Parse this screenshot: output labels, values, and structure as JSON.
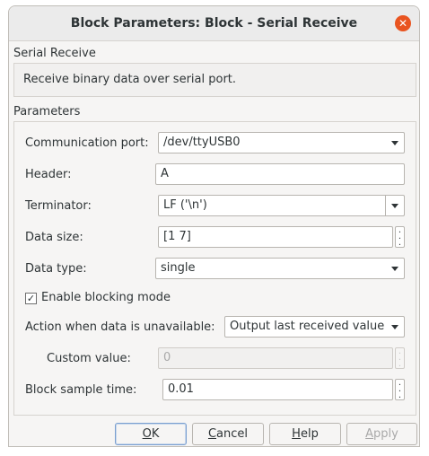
{
  "window": {
    "title": "Block Parameters: Block - Serial Receive",
    "close_glyph": "✕"
  },
  "block": {
    "name": "Serial Receive",
    "description": "Receive binary data over serial port."
  },
  "parameters": {
    "label": "Parameters",
    "communication_port": {
      "label": "Communication port:",
      "value": "/dev/ttyUSB0"
    },
    "header": {
      "label": "Header:",
      "value": "A"
    },
    "terminator": {
      "label": "Terminator:",
      "value": "LF ('\\n')"
    },
    "data_size": {
      "label": "Data size:",
      "value": "[1  7]"
    },
    "data_type": {
      "label": "Data type:",
      "value": "single"
    },
    "enable_blocking": {
      "label": "Enable blocking mode",
      "checked": true,
      "check_glyph": "✓"
    },
    "action_unavailable": {
      "label": "Action when data is unavailable:",
      "value": "Output last received value"
    },
    "custom_value": {
      "label": "Custom value:",
      "value": "0"
    },
    "sample_time": {
      "label": "Block sample time:",
      "value": "0.01"
    }
  },
  "buttons": {
    "ok": {
      "mnemonic": "O",
      "rest": "K"
    },
    "cancel": {
      "mnemonic": "C",
      "rest": "ancel"
    },
    "help": {
      "mnemonic": "H",
      "rest": "elp"
    },
    "apply": {
      "mnemonic": "A",
      "rest": "pply"
    }
  },
  "colors": {
    "close_button": "#e95420",
    "default_button_border": "#7a9fd0"
  },
  "icons": {
    "close": "close-icon",
    "dropdown": "chevron-down-icon",
    "more": "more-options-icon",
    "check": "checkmark-icon"
  }
}
